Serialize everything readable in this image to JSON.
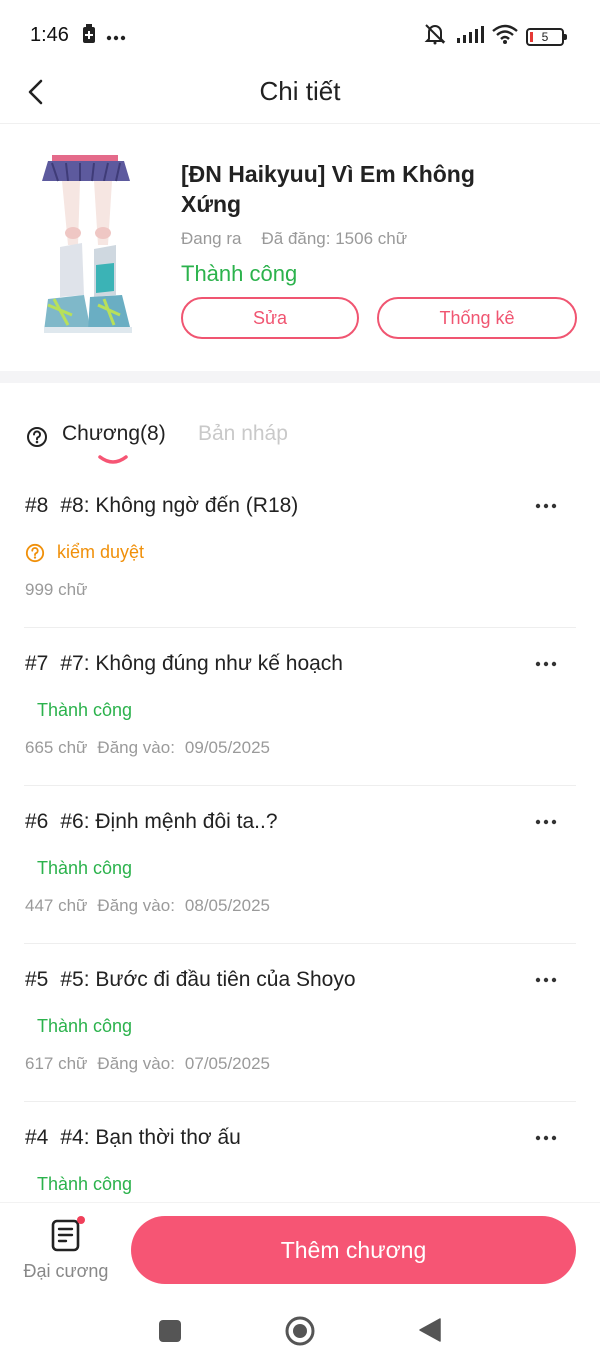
{
  "status_bar": {
    "time": "1:46",
    "battery_level": "5",
    "icons": [
      "battery-saver-icon",
      "more-dots-icon",
      "mute-icon",
      "signal-icon",
      "wifi-icon",
      "battery-icon"
    ]
  },
  "header": {
    "title": "Chi tiết",
    "back_icon": "back-chevron-icon"
  },
  "book": {
    "title": "[ĐN Haikyuu] Vì Em Không Xứng",
    "state": "Đang ra",
    "word_count": "Đã đăng: 1506 chữ",
    "status": "Thành công",
    "edit_label": "Sửa",
    "stats_label": "Thống kê"
  },
  "tabs": {
    "chapters": "Chương(8)",
    "drafts": "Bản nháp"
  },
  "chapters": [
    {
      "num": "#8",
      "title": "#8: Không ngờ đến (R18)",
      "status": "kiểm duyệt",
      "status_type": "review",
      "words": "999 chữ",
      "date_label": "",
      "date": ""
    },
    {
      "num": "#7",
      "title": "#7: Không đúng như kế hoạch",
      "status": "Thành công",
      "status_type": "success",
      "words": "665 chữ",
      "date_label": "Đăng vào:",
      "date": "09/05/2025"
    },
    {
      "num": "#6",
      "title": "#6: Định mệnh đôi ta..?",
      "status": "Thành công",
      "status_type": "success",
      "words": "447 chữ",
      "date_label": "Đăng vào:",
      "date": "08/05/2025"
    },
    {
      "num": "#5",
      "title": "#5: Bước đi đầu tiên của Shoyo",
      "status": "Thành công",
      "status_type": "success",
      "words": "617 chữ",
      "date_label": "Đăng vào:",
      "date": "07/05/2025"
    },
    {
      "num": "#4",
      "title": "#4: Bạn thời thơ ấu",
      "status": "Thành công",
      "status_type": "success",
      "words": "",
      "date_label": "",
      "date": ""
    }
  ],
  "bottom": {
    "outline_label": "Đại cương",
    "add_chapter_label": "Thêm chương"
  },
  "colors": {
    "accent": "#f65574",
    "success": "#2bb24c",
    "review": "#f0900a",
    "muted": "#9a9a9a"
  }
}
